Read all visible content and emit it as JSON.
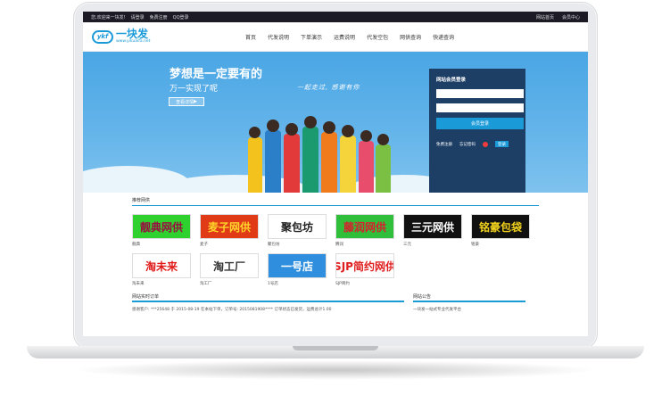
{
  "topbar": {
    "welcome": "您,欢迎来一块发!",
    "login": "请登录",
    "register": "免费注册",
    "qq_login": "QQ登录",
    "home": "网站首页",
    "member_center": "会员中心"
  },
  "logo": {
    "badge": "ykf",
    "name": "一块发",
    "url": "www.yikuaifa.net"
  },
  "nav": [
    "首页",
    "代发说明",
    "下单演示",
    "运费说明",
    "代发空包",
    "网供查询",
    "快递查询"
  ],
  "banner": {
    "title": "梦想是一定要有的",
    "subtitle": "万一实现了呢",
    "button": "查看详情",
    "script": "一起走过, 感谢有你"
  },
  "login": {
    "title": "网站会员登录",
    "username_placeholder": "",
    "password_placeholder": "",
    "submit": "会员登录",
    "register": "免费注册",
    "forgot": "忘记密码",
    "qq": "登录"
  },
  "suppliers": {
    "title": "推荐网供",
    "items": [
      {
        "logo": "靓典网供",
        "name": "靓典",
        "bg": "#2fd12f",
        "fg": "#9b0a40"
      },
      {
        "logo": "麦子网供",
        "name": "麦子",
        "bg": "#e03a17",
        "fg": "#ffd62a"
      },
      {
        "logo": "聚包坊",
        "name": "聚包坊",
        "bg": "#ffffff",
        "fg": "#222222"
      },
      {
        "logo": "藤润网供",
        "name": "腾润",
        "bg": "#2fbf3a",
        "fg": "#d81f2e"
      },
      {
        "logo": "三元网供",
        "name": "三元",
        "bg": "#111111",
        "fg": "#ffffff"
      },
      {
        "logo": "铭豪包袋",
        "name": "铭豪",
        "bg": "#111111",
        "fg": "#f2d21d"
      },
      {
        "logo": "淘未来",
        "name": "淘未来",
        "bg": "#ffffff",
        "fg": "#e01818"
      },
      {
        "logo": "淘工厂",
        "name": "淘工厂",
        "bg": "#ffffff",
        "fg": "#333333"
      },
      {
        "logo": "一号店",
        "name": "1号店",
        "bg": "#2f8fde",
        "fg": "#ffffff"
      },
      {
        "logo": "SJP简约网供",
        "name": "SJP简约",
        "bg": "#ffffff",
        "fg": "#e02020"
      }
    ]
  },
  "orders": {
    "title": "网站实时订单",
    "line": "感谢客户: ***25648 于 2015-08-19 在本站下单，订单号: 2015081908**** 订单状态已发货，运费总计1.00"
  },
  "notice": {
    "title": "网站公告",
    "line": "一块发一站式专业代发平台"
  }
}
